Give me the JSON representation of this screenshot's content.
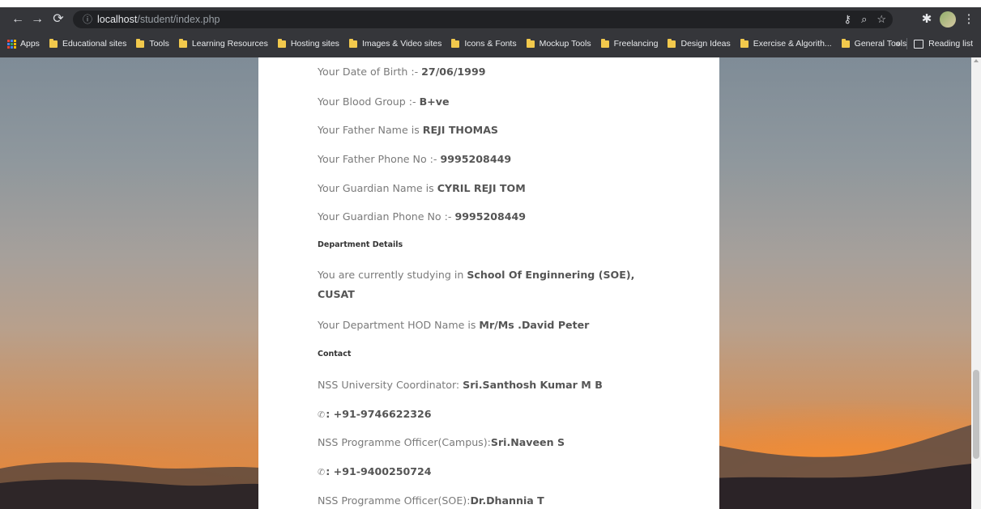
{
  "browser": {
    "url_host": "localhost",
    "url_path": "/student/index.php",
    "bookmarks": [
      {
        "label": "Apps"
      },
      {
        "label": "Educational sites"
      },
      {
        "label": "Tools"
      },
      {
        "label": "Learning Resources"
      },
      {
        "label": "Hosting sites"
      },
      {
        "label": "Images & Video sites"
      },
      {
        "label": "Icons & Fonts"
      },
      {
        "label": "Mockup Tools"
      },
      {
        "label": "Freelancing"
      },
      {
        "label": "Design Ideas"
      },
      {
        "label": "Exercise & Algorith..."
      },
      {
        "label": "General Tools"
      }
    ],
    "overflow_label": "»",
    "reading_list_label": "Reading list"
  },
  "details": {
    "dob_prefix": "Your Date of Birth :- ",
    "dob_value": "27/06/1999",
    "blood_prefix": "Your Blood Group :- ",
    "blood_value": "B+ve",
    "father_prefix": "Your Father Name is ",
    "father_value": "REJI THOMAS",
    "father_phone_prefix": "Your Father Phone No :- ",
    "father_phone_value": "9995208449",
    "guardian_prefix": "Your Guardian Name is ",
    "guardian_value": "CYRIL REJI TOM",
    "guardian_phone_prefix": "Your Guardian Phone No :- ",
    "guardian_phone_value": "9995208449"
  },
  "department": {
    "heading": "Department Details",
    "studying_prefix": "You are currently studying in ",
    "studying_value_1": "School Of Enginnering (SOE),",
    "studying_value_2": "CUSAT",
    "hod_prefix": "Your Department HOD Name is ",
    "hod_value": "Mr/Ms .David Peter"
  },
  "contact": {
    "heading": "Contact",
    "coord_prefix": "NSS University Coordinator: ",
    "coord_value": "Sri.Santhosh Kumar M B",
    "coord_phone": ": +91-9746622326",
    "campus_prefix": "NSS Programme Officer(Campus):",
    "campus_value": "Sri.Naveen S",
    "campus_phone": ": +91-9400250724",
    "soe_prefix": "NSS Programme Officer(SOE):",
    "soe_value": "Dr.Dhannia T"
  }
}
